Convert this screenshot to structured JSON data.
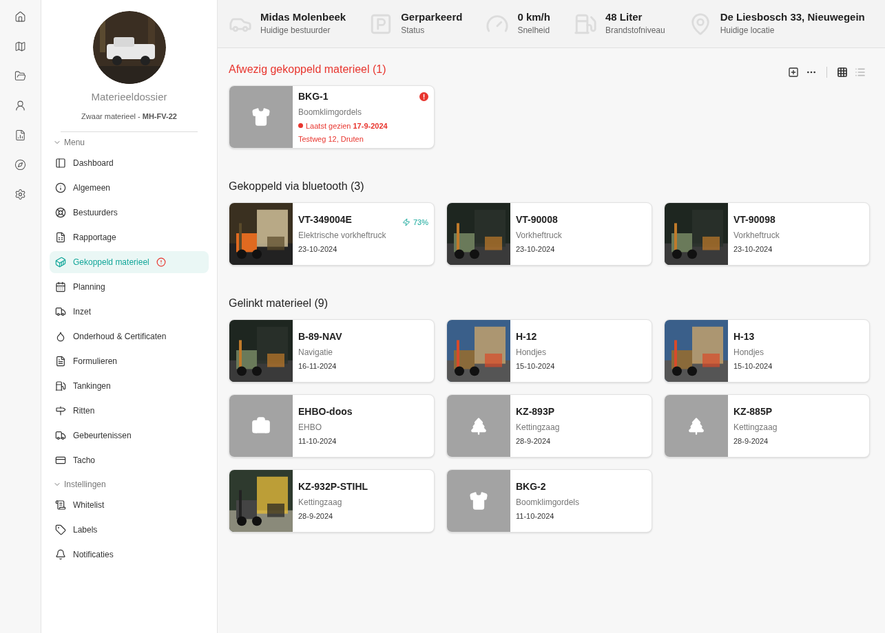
{
  "profile": {
    "title": "Materieeldossier",
    "subtitle": "Zwaar materieel - **MH-FV-22**"
  },
  "menu_sections": [
    {
      "label": "Menu",
      "expanded": true,
      "items": [
        {
          "label": "Dashboard",
          "selected": false,
          "alert": false
        },
        {
          "label": "Algemeen",
          "selected": false,
          "alert": false
        },
        {
          "label": "Bestuurders",
          "selected": false,
          "alert": false
        },
        {
          "label": "Rapportage",
          "selected": false,
          "alert": false
        },
        {
          "label": "Gekoppeld materieel",
          "selected": true,
          "alert": true
        },
        {
          "label": "Planning",
          "selected": false,
          "alert": false
        },
        {
          "label": "Inzet",
          "selected": false,
          "alert": false
        },
        {
          "label": "Onderhoud & Certificaten",
          "selected": false,
          "alert": false
        },
        {
          "label": "Formulieren",
          "selected": false,
          "alert": false
        },
        {
          "label": "Tankingen",
          "selected": false,
          "alert": false
        },
        {
          "label": "Ritten",
          "selected": false,
          "alert": false
        },
        {
          "label": "Gebeurtenissen",
          "selected": false,
          "alert": false
        },
        {
          "label": "Tacho",
          "selected": false,
          "alert": false
        }
      ]
    },
    {
      "label": "Instellingen",
      "expanded": true,
      "items": [
        {
          "label": "Whitelist",
          "selected": false,
          "alert": false
        },
        {
          "label": "Labels",
          "selected": false,
          "alert": false
        },
        {
          "label": "Notificaties",
          "selected": false,
          "alert": false
        }
      ]
    }
  ],
  "status_bar": [
    {
      "value": "Midas Molenbeek",
      "label": "Huidige bestuurder"
    },
    {
      "value": "Gerparkeerd",
      "label": "Status"
    },
    {
      "value": "0 km/h",
      "label": "Snelheid"
    },
    {
      "value": "48 Liter",
      "label": "Brandstofniveau"
    },
    {
      "value": "De Liesbosch 33, Nieuwegein",
      "label": "Huidige locatie"
    }
  ],
  "view_toggle": [
    {
      "selected": true
    },
    {
      "selected": false
    }
  ],
  "sections": [
    {
      "title": "Afwezig gekoppeld materieel (1)",
      "kind": "missing",
      "cards": [
        {
          "name": "BKG-1",
          "type": "Boomklimgordels",
          "thumb": {
            "kind": "shirt"
          },
          "alert": true,
          "last_seen": "Laatst gezien **17-9-2024**",
          "location": "Testweg 12, Druten"
        }
      ]
    },
    {
      "title": "Gekoppeld via bluetooth (3)",
      "kind": "normal",
      "cards": [
        {
          "name": "VT-349004E",
          "type": "Elektrische vorkheftruck",
          "date": "23-10-2024",
          "battery": "73%"
        },
        {
          "name": "VT-90008",
          "type": "Vorkheftruck",
          "date": "23-10-2024"
        },
        {
          "name": "VT-90098",
          "type": "Vorkheftruck",
          "date": "23-10-2024"
        }
      ]
    },
    {
      "title": "Gelinkt materieel (9)",
      "kind": "normal",
      "cards": [
        {
          "name": "B-89-NAV",
          "type": "Navigatie",
          "date": "16-11-2024"
        },
        {
          "name": "H-12",
          "type": "Hondjes",
          "date": "15-10-2024"
        },
        {
          "name": "H-13",
          "type": "Hondjes",
          "date": "15-10-2024"
        },
        {
          "name": "EHBO-doos",
          "type": "EHBO",
          "date": "11-10-2024",
          "thumb": {
            "kind": "firstaid"
          }
        },
        {
          "name": "KZ-893P",
          "type": "Kettingzaag",
          "date": "28-9-2024",
          "thumb": {
            "kind": "tree"
          }
        },
        {
          "name": "KZ-885P",
          "type": "Kettingzaag",
          "date": "28-9-2024",
          "thumb": {
            "kind": "tree"
          }
        },
        {
          "name": "KZ-932P-STIHL",
          "type": "Kettingzaag",
          "date": "28-9-2024"
        },
        {
          "name": "BKG-2",
          "type": "Boomklimgordels",
          "date": "11-10-2024",
          "thumb": {
            "kind": "shirt"
          }
        }
      ]
    }
  ]
}
